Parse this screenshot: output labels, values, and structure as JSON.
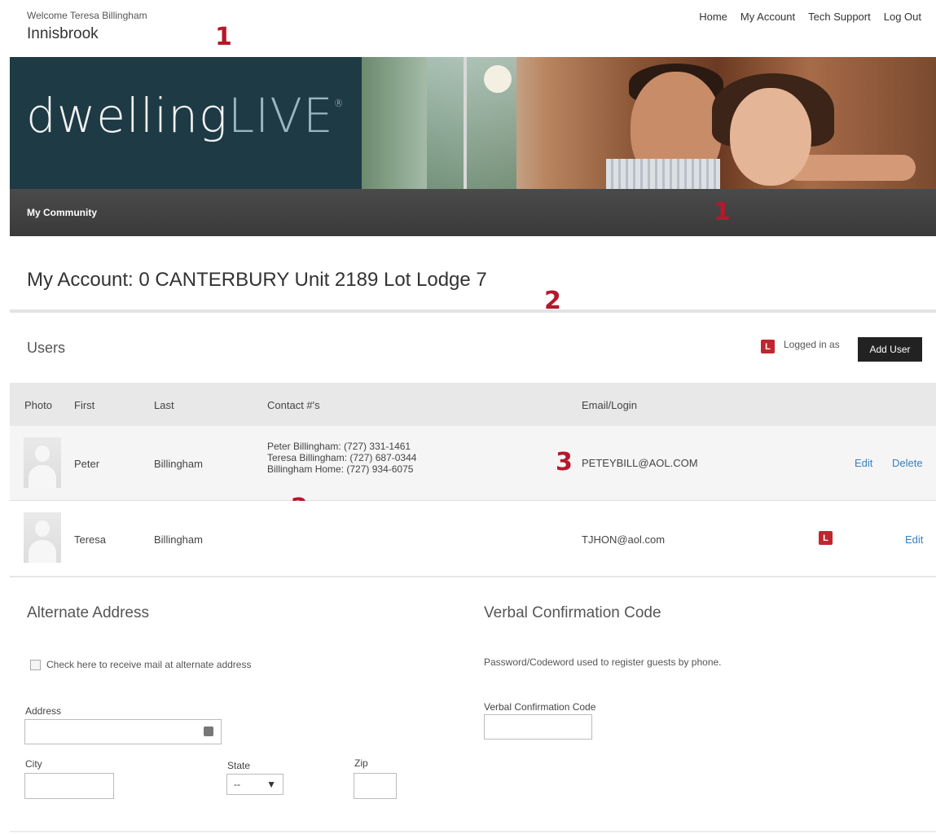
{
  "header": {
    "welcome": "Welcome Teresa Billingham",
    "community": "Innisbrook",
    "nav": [
      "Home",
      "My Account",
      "Tech Support",
      "Log Out"
    ]
  },
  "annotations": {
    "m1": "1",
    "m2": "2",
    "m3": "3"
  },
  "banner": {
    "logo_main": "dwelling",
    "logo_accent": "LIVE",
    "logo_mark": "®"
  },
  "navbar": {
    "item": "My Community"
  },
  "account": {
    "title": "My Account: 0 CANTERBURY Unit 2189 Lot Lodge 7"
  },
  "users": {
    "title": "Users",
    "legend_badge": "L",
    "legend_text": "Logged in as",
    "add_user": "Add User",
    "columns": [
      "Photo",
      "First",
      "Last",
      "Contact #'s",
      "Email/Login"
    ],
    "rows": [
      {
        "first": "Peter",
        "last": "Billingham",
        "contacts": [
          "Peter Billingham:  (727) 331-1461",
          "Teresa Billingham:  (727) 687-0344",
          "Billingham Home:  (727) 934-6075"
        ],
        "email": "PETEYBILL@AOL.COM",
        "edit": "Edit",
        "delete": "Delete"
      },
      {
        "first": "Teresa",
        "last": "Billingham",
        "badge": "L",
        "email": "TJHON@aol.com",
        "edit": "Edit"
      }
    ]
  },
  "alternate_address": {
    "title": "Alternate Address",
    "checkbox_label": "Check here to receive mail at alternate address",
    "address_label": "Address",
    "city_label": "City",
    "state_label": "State",
    "state_value": "--",
    "zip_label": "Zip"
  },
  "verbal": {
    "title": "Verbal Confirmation Code",
    "description": "Password/Codeword used to register guests by phone.",
    "field_label": "Verbal Confirmation Code"
  },
  "colors": {
    "accent": "#b5182c",
    "link": "#3a7fc0",
    "navbar": "#3f3f3f",
    "banner_dark": "#1d3a45"
  }
}
